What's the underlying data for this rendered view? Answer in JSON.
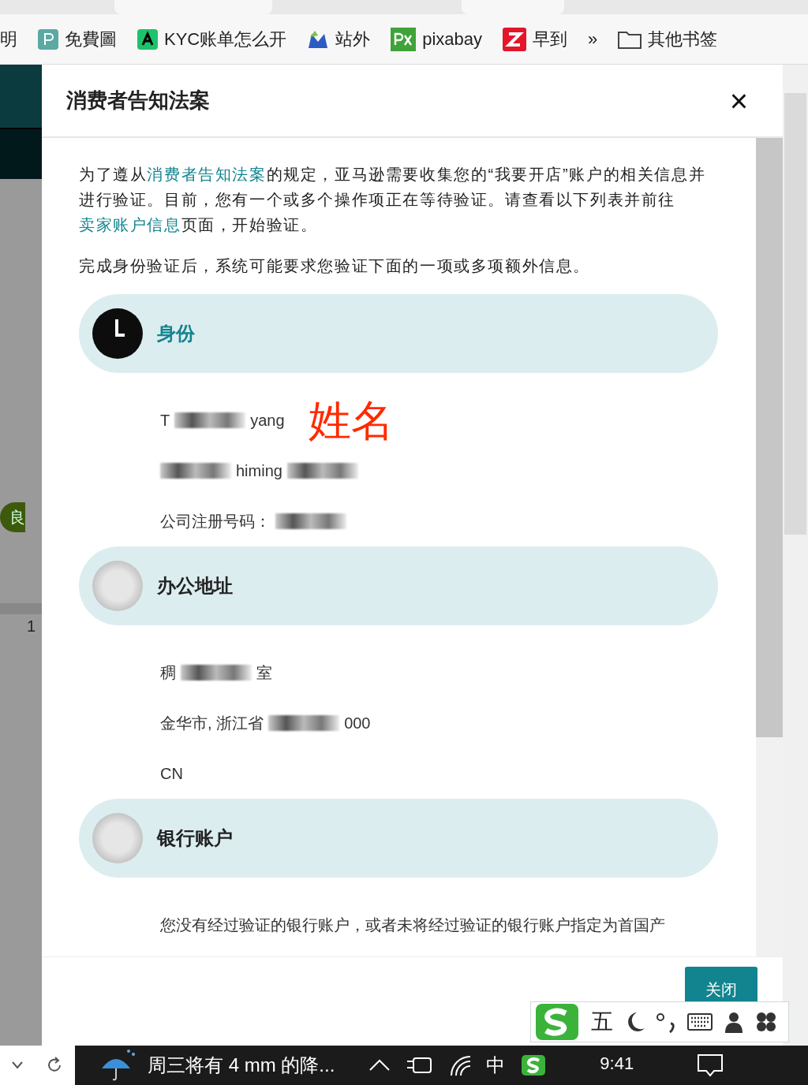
{
  "bookmarks": [
    {
      "label": "明"
    },
    {
      "label": "免費圖"
    },
    {
      "label": "KYC账单怎么开"
    },
    {
      "label": "站外"
    },
    {
      "label": "pixabay"
    },
    {
      "label": "早到"
    }
  ],
  "more_bookmarks": "»",
  "other_bookmarks": "其他书签",
  "background_page": {
    "badge": "良",
    "number": "1"
  },
  "dialog": {
    "title": "消费者告知法案",
    "close": "×",
    "paragraphs": [
      [
        {
          "text": "为了遵从",
          "link": false
        },
        {
          "text": "消费者告知法案",
          "link": true
        },
        {
          "text": "的规定，亚马逊需要收集您的“我要开店”账户的相关信息并进行验证。目前，您有一个或多个操作项正在等待验证。请查看以下列表并前往",
          "link": false
        },
        {
          "text": "卖家账户信息",
          "link": true
        },
        {
          "text": "页面，开始验证。",
          "link": false
        }
      ],
      [
        {
          "text": "完成身份验证后，系统可能要求您验证下面的一项或多项额外信息。",
          "link": false
        }
      ]
    ],
    "sections": [
      {
        "title": "身份",
        "kind": "pending",
        "lines": [
          [
            {
              "kind": "text",
              "text": "T"
            },
            {
              "kind": "redacted"
            },
            {
              "kind": "text",
              "text": "yang"
            },
            {
              "kind": "note",
              "text": "姓名"
            }
          ],
          [
            {
              "kind": "redacted"
            },
            {
              "kind": "text",
              "text": "himing"
            },
            {
              "kind": "redacted"
            }
          ],
          [
            {
              "kind": "text",
              "text": "公司注册号码："
            },
            {
              "kind": "redacted"
            }
          ]
        ]
      },
      {
        "title": "办公地址",
        "kind": "not_started",
        "lines": [
          [
            {
              "kind": "text",
              "text": "稠"
            },
            {
              "kind": "redacted"
            },
            {
              "kind": "text",
              "text": "室"
            }
          ],
          [
            {
              "kind": "text",
              "text": "金华市, 浙江省"
            },
            {
              "kind": "redacted"
            },
            {
              "kind": "text",
              "text": "000"
            }
          ],
          [
            {
              "kind": "text",
              "text": "CN"
            }
          ]
        ]
      },
      {
        "title": "银行账户",
        "kind": "not_started",
        "lines": [
          [
            {
              "kind": "text",
              "text": "您没有经过验证的银行账户，或者未将经过验证的银行账户指定为首国产"
            }
          ]
        ]
      }
    ],
    "close_button": "关闭"
  },
  "ime_toolbar": {
    "mode": "五"
  },
  "taskbar": {
    "weather": "周三将有 4 mm 的降...",
    "input_language": "中",
    "time": "9:41"
  }
}
